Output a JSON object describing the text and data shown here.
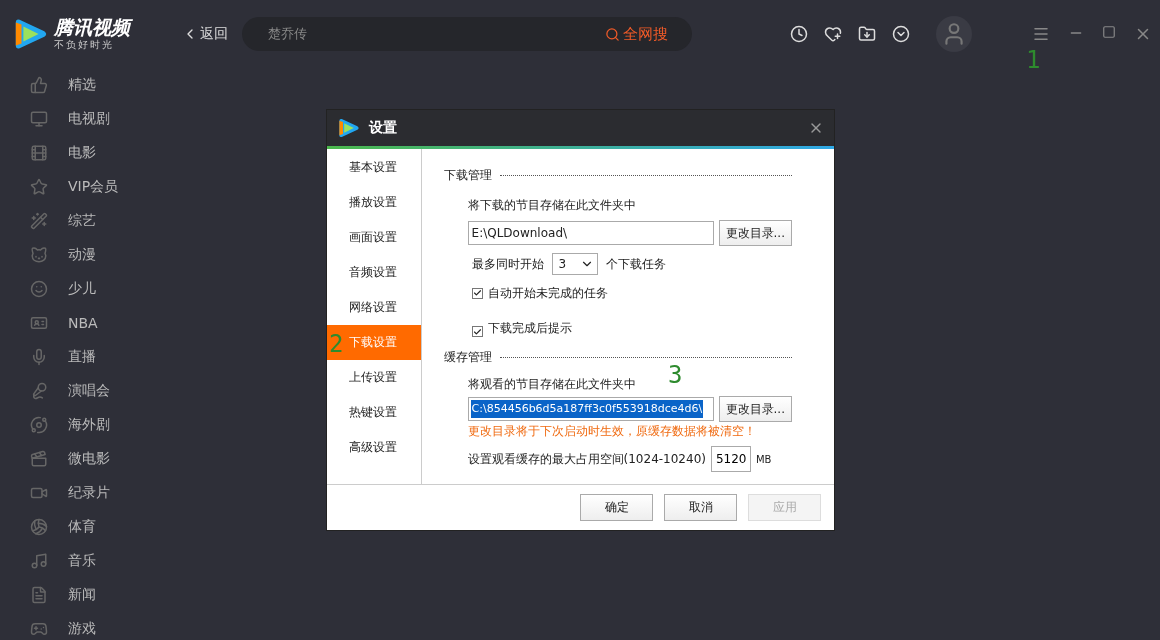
{
  "app": {
    "logo_title": "腾讯视频",
    "logo_slogan": "不负好时光",
    "back": "返回",
    "search": {
      "value": "楚乔传",
      "button": "全网搜"
    }
  },
  "sidebar": {
    "items": [
      {
        "label": "精选"
      },
      {
        "label": "电视剧"
      },
      {
        "label": "电影"
      },
      {
        "label": "VIP会员"
      },
      {
        "label": "综艺"
      },
      {
        "label": "动漫"
      },
      {
        "label": "少儿"
      },
      {
        "label": "NBA"
      },
      {
        "label": "直播"
      },
      {
        "label": "演唱会"
      },
      {
        "label": "海外剧"
      },
      {
        "label": "微电影"
      },
      {
        "label": "纪录片"
      },
      {
        "label": "体育"
      },
      {
        "label": "音乐"
      },
      {
        "label": "新闻"
      },
      {
        "label": "游戏"
      }
    ]
  },
  "annotations": [
    {
      "text": "1"
    },
    {
      "text": "2"
    },
    {
      "text": "3"
    }
  ],
  "dialog": {
    "title": "设置",
    "nav": [
      {
        "label": "基本设置",
        "selected": false
      },
      {
        "label": "播放设置",
        "selected": false
      },
      {
        "label": "画面设置",
        "selected": false
      },
      {
        "label": "音频设置",
        "selected": false
      },
      {
        "label": "网络设置",
        "selected": false
      },
      {
        "label": "下载设置",
        "selected": true
      },
      {
        "label": "上传设置",
        "selected": false
      },
      {
        "label": "热键设置",
        "selected": false
      },
      {
        "label": "高级设置",
        "selected": false
      }
    ],
    "download": {
      "heading": "下载管理",
      "folder_label": "将下载的节目存储在此文件夹中",
      "folder": "E:\\QLDownload\\",
      "change_button": "更改目录...",
      "max_prefix": "最多同时开始",
      "max_value": "3",
      "max_suffix": "个下载任务",
      "checks": [
        {
          "label": "自动开始未完成的任务",
          "checked": true
        },
        {
          "label": "下载完成后提示",
          "checked": true
        }
      ]
    },
    "cache": {
      "heading": "缓存管理",
      "folder_label": "将观看的节目存储在此文件夹中",
      "folder": "C:\\854456b6d5a187ff3c0f553918dce4d6\\",
      "change_button": "更改目录...",
      "warning": "更改目录将于下次启动时生效，原缓存数据将被清空！",
      "size_label": "设置观看缓存的最大占用空间(1024-10240)",
      "size_value": "5120",
      "size_unit": "MB"
    },
    "buttons": [
      {
        "label": "确定",
        "disabled": false
      },
      {
        "label": "取消",
        "disabled": false
      },
      {
        "label": "应用",
        "disabled": true
      }
    ]
  }
}
